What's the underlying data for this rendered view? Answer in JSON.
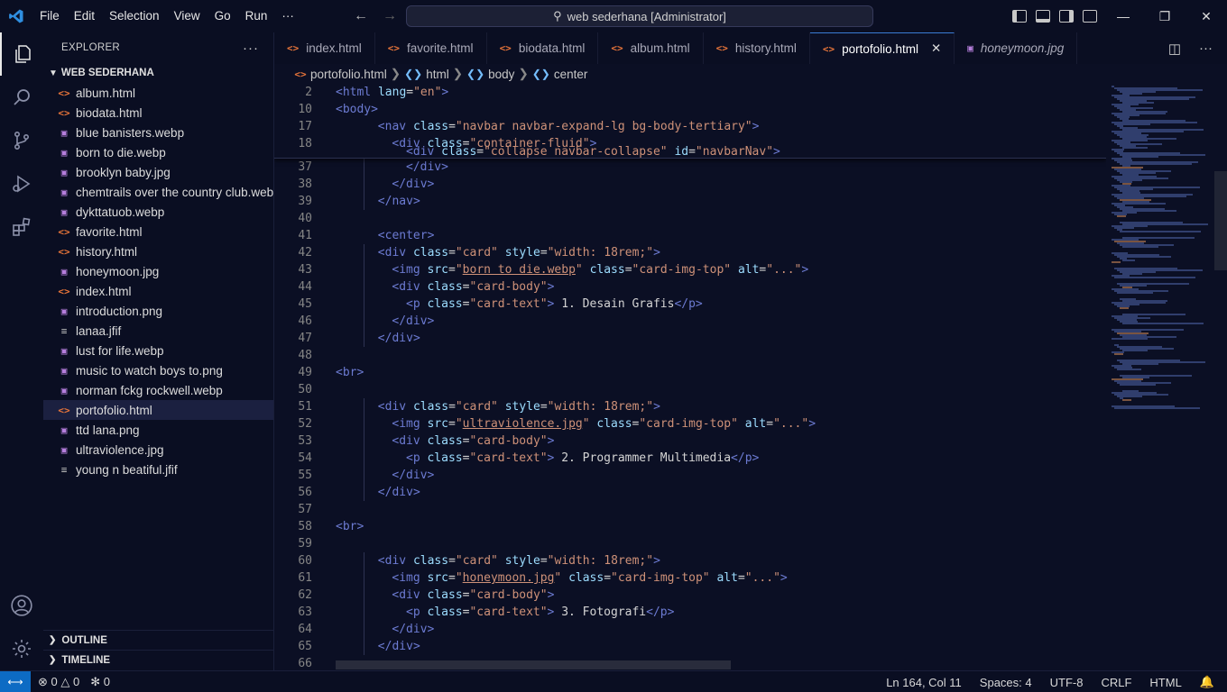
{
  "menu": [
    "File",
    "Edit",
    "Selection",
    "View",
    "Go",
    "Run",
    "···"
  ],
  "command_center": "web sederhana [Administrator]",
  "explorer": {
    "title": "EXPLORER",
    "folder": "WEB SEDERHANA",
    "files": [
      {
        "name": "album.html",
        "kind": "html"
      },
      {
        "name": "biodata.html",
        "kind": "html"
      },
      {
        "name": "blue banisters.webp",
        "kind": "img"
      },
      {
        "name": "born to die.webp",
        "kind": "img"
      },
      {
        "name": "brooklyn baby.jpg",
        "kind": "img"
      },
      {
        "name": "chemtrails over the country club.webp",
        "kind": "img"
      },
      {
        "name": "dykttatuob.webp",
        "kind": "img"
      },
      {
        "name": "favorite.html",
        "kind": "html"
      },
      {
        "name": "history.html",
        "kind": "html"
      },
      {
        "name": "honeymoon.jpg",
        "kind": "img"
      },
      {
        "name": "index.html",
        "kind": "html"
      },
      {
        "name": "introduction.png",
        "kind": "img"
      },
      {
        "name": "lanaa.jfif",
        "kind": "txt"
      },
      {
        "name": "lust for life.webp",
        "kind": "img"
      },
      {
        "name": "music to watch boys to.png",
        "kind": "img"
      },
      {
        "name": "norman fckg rockwell.webp",
        "kind": "img"
      },
      {
        "name": "portofolio.html",
        "kind": "html",
        "selected": true
      },
      {
        "name": "ttd lana.png",
        "kind": "img"
      },
      {
        "name": "ultraviolence.jpg",
        "kind": "img"
      },
      {
        "name": "young n beatiful.jfif",
        "kind": "txt"
      }
    ],
    "outline": "OUTLINE",
    "timeline": "TIMELINE"
  },
  "tabs": [
    {
      "label": "index.html",
      "kind": "html"
    },
    {
      "label": "favorite.html",
      "kind": "html"
    },
    {
      "label": "biodata.html",
      "kind": "html"
    },
    {
      "label": "album.html",
      "kind": "html"
    },
    {
      "label": "history.html",
      "kind": "html"
    },
    {
      "label": "portofolio.html",
      "kind": "html",
      "active": true
    },
    {
      "label": "honeymoon.jpg",
      "kind": "img",
      "preview": true
    }
  ],
  "breadcrumb": [
    "portofolio.html",
    "html",
    "body",
    "center"
  ],
  "sticky_lines": [
    {
      "n": "2",
      "indent": 0,
      "code": "<html lang=\"en\">"
    },
    {
      "n": "10",
      "indent": 0,
      "code": "<body>"
    },
    {
      "n": "17",
      "indent": 3,
      "code": "<nav class=\"navbar navbar-expand-lg bg-body-tertiary\">"
    },
    {
      "n": "18",
      "indent": 4,
      "code": "<div class=\"container-fluid\">"
    }
  ],
  "sticky_partial": "<div class=\"collapse navbar-collapse\" id=\"navbarNav\">",
  "lines": [
    {
      "n": "37",
      "indent": 5,
      "code": "</div>"
    },
    {
      "n": "38",
      "indent": 4,
      "code": "</div>"
    },
    {
      "n": "39",
      "indent": 3,
      "code": "</nav>"
    },
    {
      "n": "40",
      "indent": 0,
      "code": ""
    },
    {
      "n": "41",
      "indent": 3,
      "code": "<center>"
    },
    {
      "n": "42",
      "indent": 3,
      "code": "<div class=\"card\" style=\"width: 18rem;\">"
    },
    {
      "n": "43",
      "indent": 4,
      "code": "<img src=\"born to die.webp\" class=\"card-img-top\" alt=\"...\">"
    },
    {
      "n": "44",
      "indent": 4,
      "code": "<div class=\"card-body\">"
    },
    {
      "n": "45",
      "indent": 5,
      "code": "<p class=\"card-text\"> 1. Desain Grafis</p>"
    },
    {
      "n": "46",
      "indent": 4,
      "code": "</div>"
    },
    {
      "n": "47",
      "indent": 3,
      "code": "</div>"
    },
    {
      "n": "48",
      "indent": 0,
      "code": ""
    },
    {
      "n": "49",
      "indent": 0,
      "code": "<br>"
    },
    {
      "n": "50",
      "indent": 0,
      "code": ""
    },
    {
      "n": "51",
      "indent": 3,
      "code": "<div class=\"card\" style=\"width: 18rem;\">"
    },
    {
      "n": "52",
      "indent": 4,
      "code": "<img src=\"ultraviolence.jpg\" class=\"card-img-top\" alt=\"...\">"
    },
    {
      "n": "53",
      "indent": 4,
      "code": "<div class=\"card-body\">"
    },
    {
      "n": "54",
      "indent": 5,
      "code": "<p class=\"card-text\"> 2. Programmer Multimedia</p>"
    },
    {
      "n": "55",
      "indent": 4,
      "code": "</div>"
    },
    {
      "n": "56",
      "indent": 3,
      "code": "</div>"
    },
    {
      "n": "57",
      "indent": 0,
      "code": ""
    },
    {
      "n": "58",
      "indent": 0,
      "code": "<br>"
    },
    {
      "n": "59",
      "indent": 0,
      "code": ""
    },
    {
      "n": "60",
      "indent": 3,
      "code": "<div class=\"card\" style=\"width: 18rem;\">"
    },
    {
      "n": "61",
      "indent": 4,
      "code": "<img src=\"honeymoon.jpg\" class=\"card-img-top\" alt=\"...\">"
    },
    {
      "n": "62",
      "indent": 4,
      "code": "<div class=\"card-body\">"
    },
    {
      "n": "63",
      "indent": 5,
      "code": "<p class=\"card-text\"> 3. Fotografi</p>"
    },
    {
      "n": "64",
      "indent": 4,
      "code": "</div>"
    },
    {
      "n": "65",
      "indent": 3,
      "code": "</div>"
    },
    {
      "n": "66",
      "indent": 0,
      "code": ""
    }
  ],
  "status": {
    "errors": "0",
    "warnings": "0",
    "ports": "0",
    "position": "Ln 164, Col 11",
    "spaces": "Spaces: 4",
    "encoding": "UTF-8",
    "eol": "CRLF",
    "language": "HTML"
  },
  "colors": {
    "tag": "#6c7bd2",
    "attr": "#9cdcfe",
    "string": "#ce9178",
    "text": "#d4d4d4",
    "accent": "#0d6bc4",
    "html_icon": "#e8753a",
    "image_icon": "#b57edc"
  }
}
